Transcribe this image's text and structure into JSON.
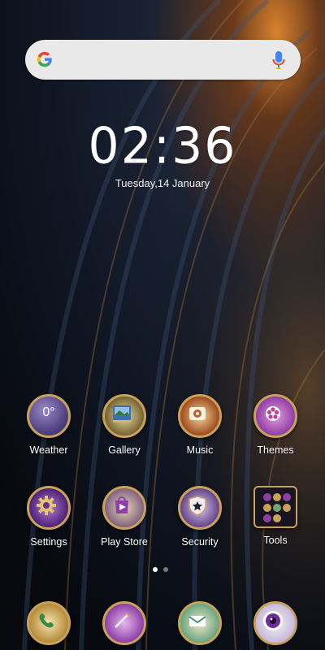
{
  "search": {
    "google_logo": "google-logo",
    "mic_icon": "microphone-icon"
  },
  "clock": {
    "time": "02:36",
    "date": "Tuesday,14 January"
  },
  "apps_row1": [
    {
      "label": "Weather",
      "icon_text": "0°"
    },
    {
      "label": "Gallery"
    },
    {
      "label": "Music"
    },
    {
      "label": "Themes"
    }
  ],
  "apps_row2": [
    {
      "label": "Settings"
    },
    {
      "label": "Play Store"
    },
    {
      "label": "Security"
    },
    {
      "label": "Tools"
    }
  ],
  "dock": [
    {
      "icon": "phone-icon"
    },
    {
      "icon": "messages-icon"
    },
    {
      "icon": "mail-icon"
    },
    {
      "icon": "camera-icon"
    }
  ],
  "page_indicator": {
    "pages": 2,
    "current": 1
  },
  "colors": {
    "gold": "#c9a25a",
    "purple": "#8e3fa6",
    "search_bg": "#e9e9e9"
  }
}
